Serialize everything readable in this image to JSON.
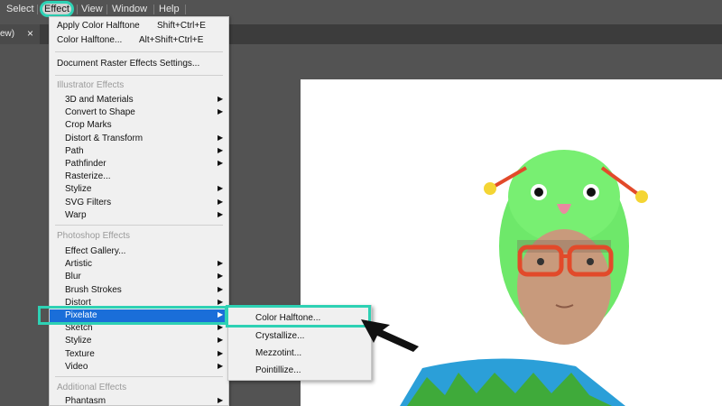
{
  "menubar": {
    "items": [
      {
        "label": "Select"
      },
      {
        "label": "Effect"
      },
      {
        "label": "View"
      },
      {
        "label": "Window"
      },
      {
        "label": "Help"
      }
    ]
  },
  "tab": {
    "label": "ew)",
    "close": "×"
  },
  "menu": {
    "apply_color_halftone": {
      "label": "Apply Color Halftone",
      "shortcut": "Shift+Ctrl+E"
    },
    "color_halftone": {
      "label": "Color Halftone...",
      "shortcut": "Alt+Shift+Ctrl+E"
    },
    "document_raster": {
      "label": "Document Raster Effects Settings..."
    },
    "illustrator_header": "Illustrator Effects",
    "illustrator_items": [
      {
        "label": "3D and Materials",
        "submenu": true
      },
      {
        "label": "Convert to Shape",
        "submenu": true
      },
      {
        "label": "Crop Marks",
        "submenu": false
      },
      {
        "label": "Distort & Transform",
        "submenu": true
      },
      {
        "label": "Path",
        "submenu": true
      },
      {
        "label": "Pathfinder",
        "submenu": true
      },
      {
        "label": "Rasterize...",
        "submenu": false
      },
      {
        "label": "Stylize",
        "submenu": true
      },
      {
        "label": "SVG Filters",
        "submenu": true
      },
      {
        "label": "Warp",
        "submenu": true
      }
    ],
    "photoshop_header": "Photoshop Effects",
    "photoshop_items": [
      {
        "label": "Effect Gallery...",
        "submenu": false
      },
      {
        "label": "Artistic",
        "submenu": true
      },
      {
        "label": "Blur",
        "submenu": true
      },
      {
        "label": "Brush Strokes",
        "submenu": true
      },
      {
        "label": "Distort",
        "submenu": true
      },
      {
        "label": "Pixelate",
        "submenu": true
      },
      {
        "label": "Sketch",
        "submenu": true
      },
      {
        "label": "Stylize",
        "submenu": true
      },
      {
        "label": "Texture",
        "submenu": true
      },
      {
        "label": "Video",
        "submenu": true
      }
    ],
    "additional_header": "Additional Effects",
    "additional_items": [
      {
        "label": "Phantasm",
        "submenu": true
      }
    ],
    "submenu_arrow": "▶"
  },
  "submenu": {
    "items": [
      {
        "label": "Color Halftone..."
      },
      {
        "label": "Crystallize..."
      },
      {
        "label": "Mezzotint..."
      },
      {
        "label": "Pointillize..."
      }
    ]
  },
  "colors": {
    "highlight": "#1a6ed9",
    "callout": "#2ed1b4",
    "costume_green": "#6ee86a",
    "shirt_blue": "#2b9fd8"
  }
}
